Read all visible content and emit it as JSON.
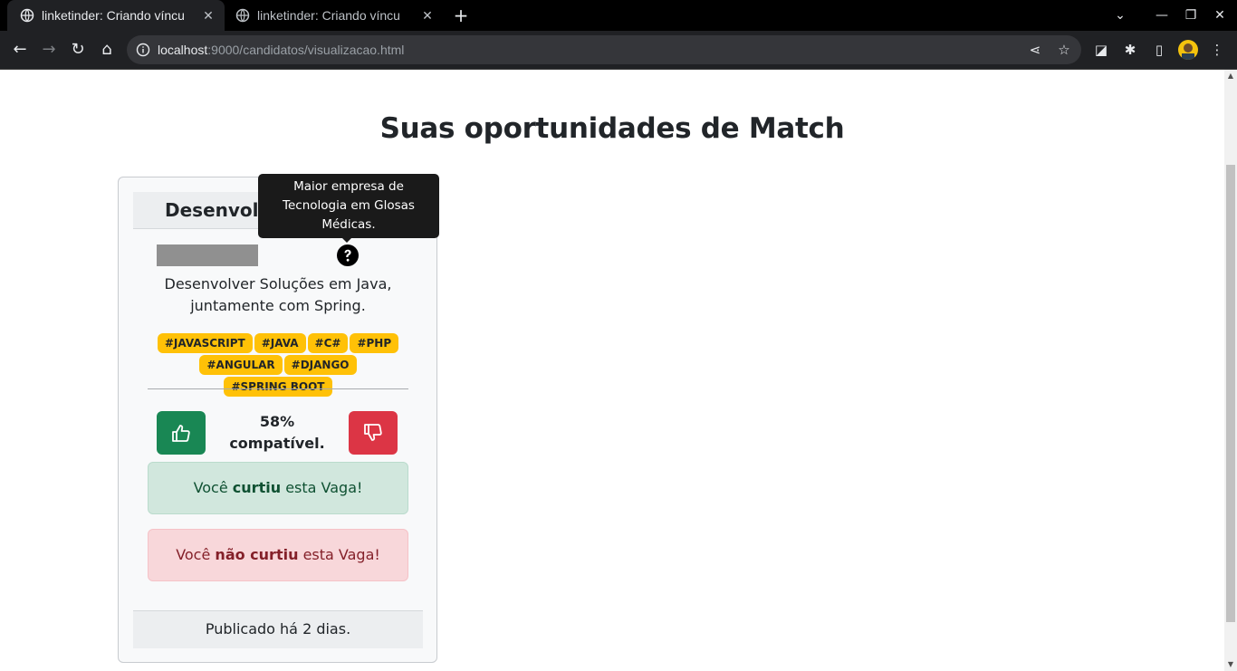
{
  "browser": {
    "tabs": [
      {
        "title": "linketinder: Criando víncu",
        "active": true
      },
      {
        "title": "linketinder: Criando víncu",
        "active": false
      }
    ],
    "url_host": "localhost",
    "url_path": ":9000/candidatos/visualizacao.html"
  },
  "page": {
    "heading": "Suas oportunidades de Match"
  },
  "card": {
    "title": "Desenvolvedor",
    "tooltip": "Maior empresa de Tecnologia em Glosas Médicas.",
    "description": "Desenvolver Soluções em Java, juntamente com Spring.",
    "tags": [
      "#JAVASCRIPT",
      "#JAVA",
      "#C#",
      "#PHP",
      "#ANGULAR",
      "#DJANGO",
      "#SPRING BOOT"
    ],
    "compat_percent": "58%",
    "compat_label": "compatível.",
    "liked_alert": {
      "prefix": "Você",
      "strong": "curtiu",
      "suffix": "esta Vaga!"
    },
    "disliked_alert": {
      "prefix": "Você",
      "strong": "não curtiu",
      "suffix": "esta Vaga!"
    },
    "footer": "Publicado há 2 dias."
  },
  "colors": {
    "tag_bg": "#ffc107",
    "like": "#198754",
    "dislike": "#dc3545"
  }
}
